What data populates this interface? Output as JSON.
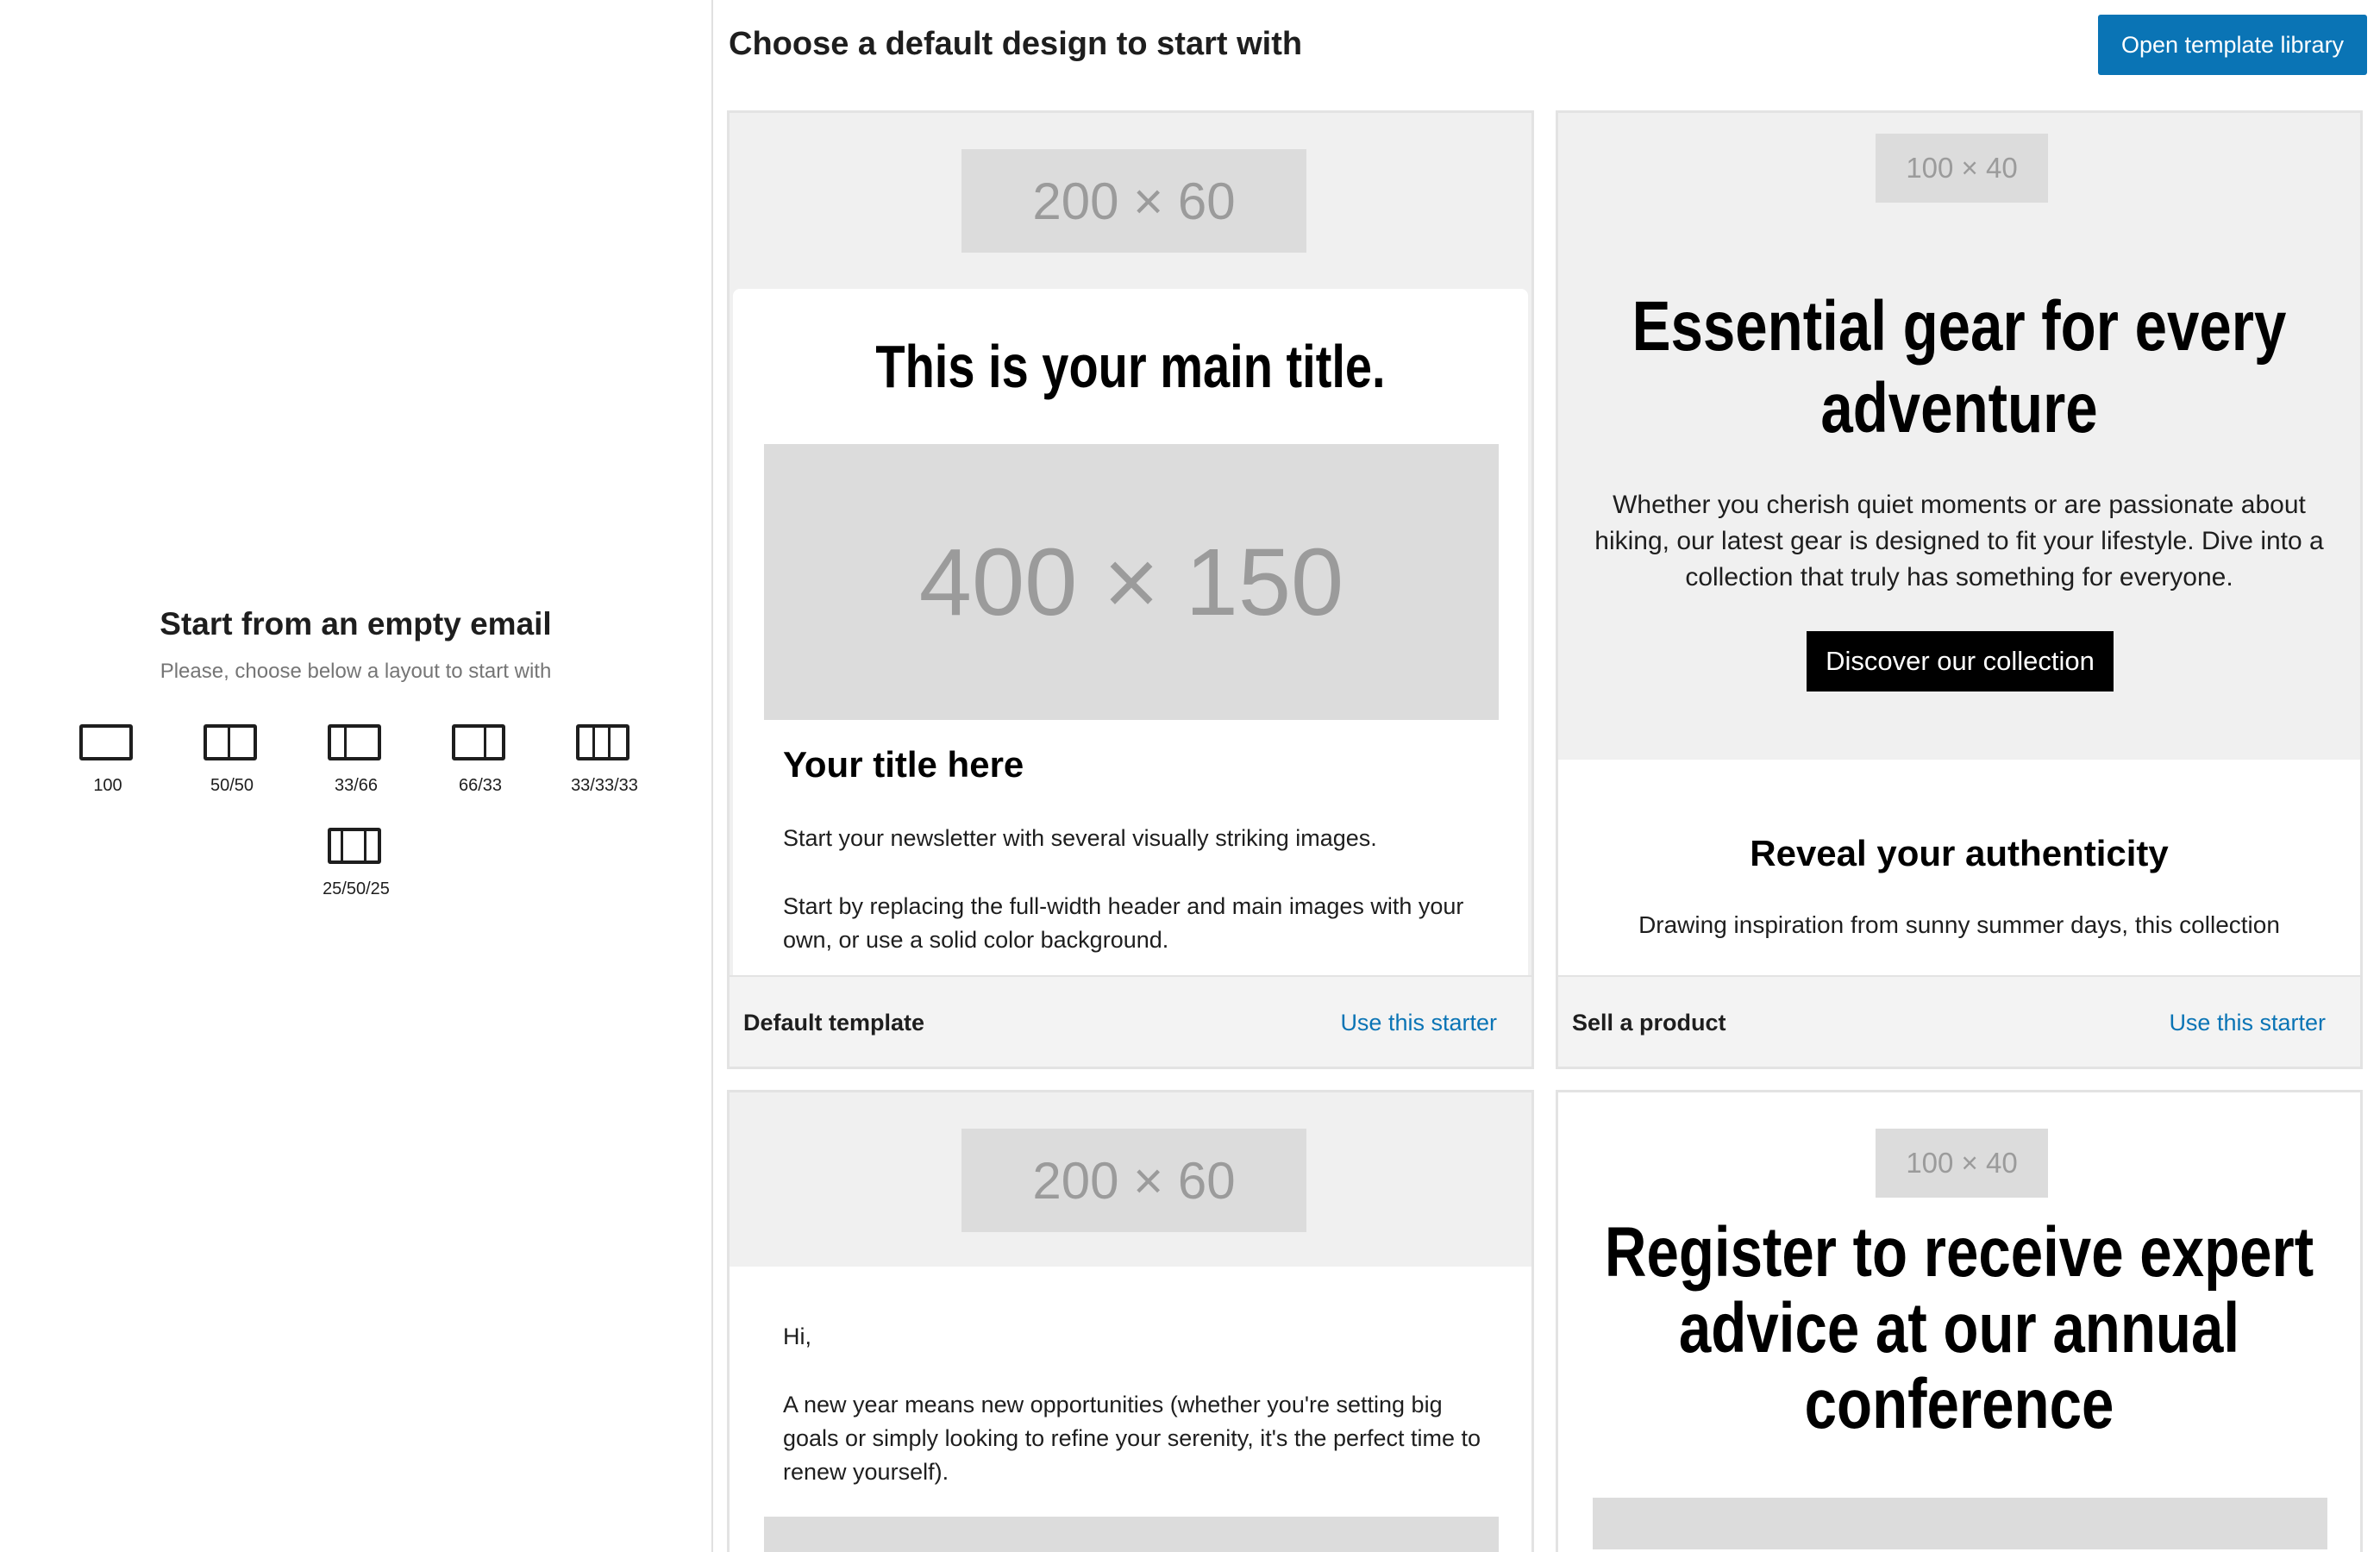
{
  "empty_email": {
    "title": "Start from an empty email",
    "subtitle": "Please, choose below a layout to start with",
    "layouts": [
      {
        "label": "100"
      },
      {
        "label": "50/50"
      },
      {
        "label": "33/66"
      },
      {
        "label": "66/33"
      },
      {
        "label": "33/33/33"
      },
      {
        "label": "25/50/25"
      }
    ]
  },
  "header": {
    "title": "Choose a default design to start with",
    "library_button": "Open template library"
  },
  "cards": [
    {
      "name": "Default template",
      "action": "Use this starter",
      "logo_placeholder": "200 × 60",
      "main_title": "This is your main title.",
      "image_placeholder": "400 × 150",
      "section_title": "Your title here",
      "paragraph1": "Start your newsletter with several visually striking images.",
      "paragraph2": "Start by replacing the full-width header and main images with your own, or use a solid color background."
    },
    {
      "name": "Sell a product",
      "action": "Use this starter",
      "logo_placeholder": "100 × 40",
      "main_title": "Essential gear for every adventure",
      "paragraph": "Whether you cherish quiet moments or are passionate about hiking, our latest gear is designed to fit your lifestyle. Dive into a collection that truly has something for everyone.",
      "cta": "Discover our collection",
      "section_title": "Reveal your authenticity",
      "section_paragraph": "Drawing inspiration from sunny summer days, this collection"
    },
    {
      "logo_placeholder": "200 × 60",
      "greeting": "Hi,",
      "paragraph": "A new year means new opportunities (whether you're setting big goals or simply looking to refine your serenity, it's the perfect time to renew yourself)."
    },
    {
      "logo_placeholder": "100 × 40",
      "main_title": "Register to receive expert advice at our annual conference"
    }
  ]
}
